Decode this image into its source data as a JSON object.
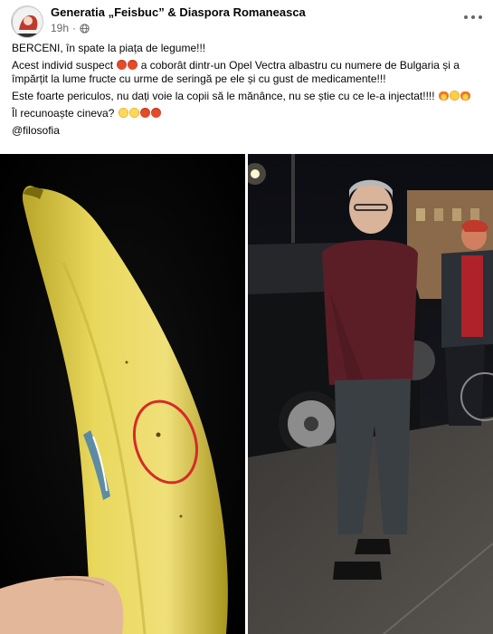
{
  "post": {
    "page_name": "Generatia „Feisbuc” & Diaspora Romaneasca",
    "time": "19h",
    "separator": "·",
    "lines": [
      "BERCENI, în spate la piața de legume!!!",
      "Acest individ suspect",
      "a coborât dintr-un Opel Vectra albastru cu numere de Bulgaria și a împărțit la lume fructe cu urme de seringă pe ele și cu gust de medicamente!!!",
      "Este foarte periculos, nu dați voie la copii să le mănânce, nu se știe cu ce le-a injectat!!!!",
      "Îl recunoaște cineva?",
      "@filosofia"
    ],
    "icons": {
      "avatar": "avatar-illustration",
      "privacy": "globe-icon",
      "more": "more-options-icon",
      "emoji_set_1": [
        "angry-face-emoji",
        "angry-face-emoji"
      ],
      "emoji_set_2": [
        "fire-emoji",
        "flushed-face-emoji",
        "fire-emoji"
      ],
      "emoji_set_3": [
        "thinking-face-emoji",
        "thinking-face-emoji",
        "angry-face-emoji",
        "angry-face-emoji"
      ]
    }
  },
  "colors": {
    "secondary_text": "#65676b",
    "highlight_circle": "#d62a2a",
    "banana_yellow": "#e8d75a"
  },
  "images": {
    "left": "banana-with-circled-mark-photo",
    "right": "man-standing-on-street-at-night-photo"
  }
}
